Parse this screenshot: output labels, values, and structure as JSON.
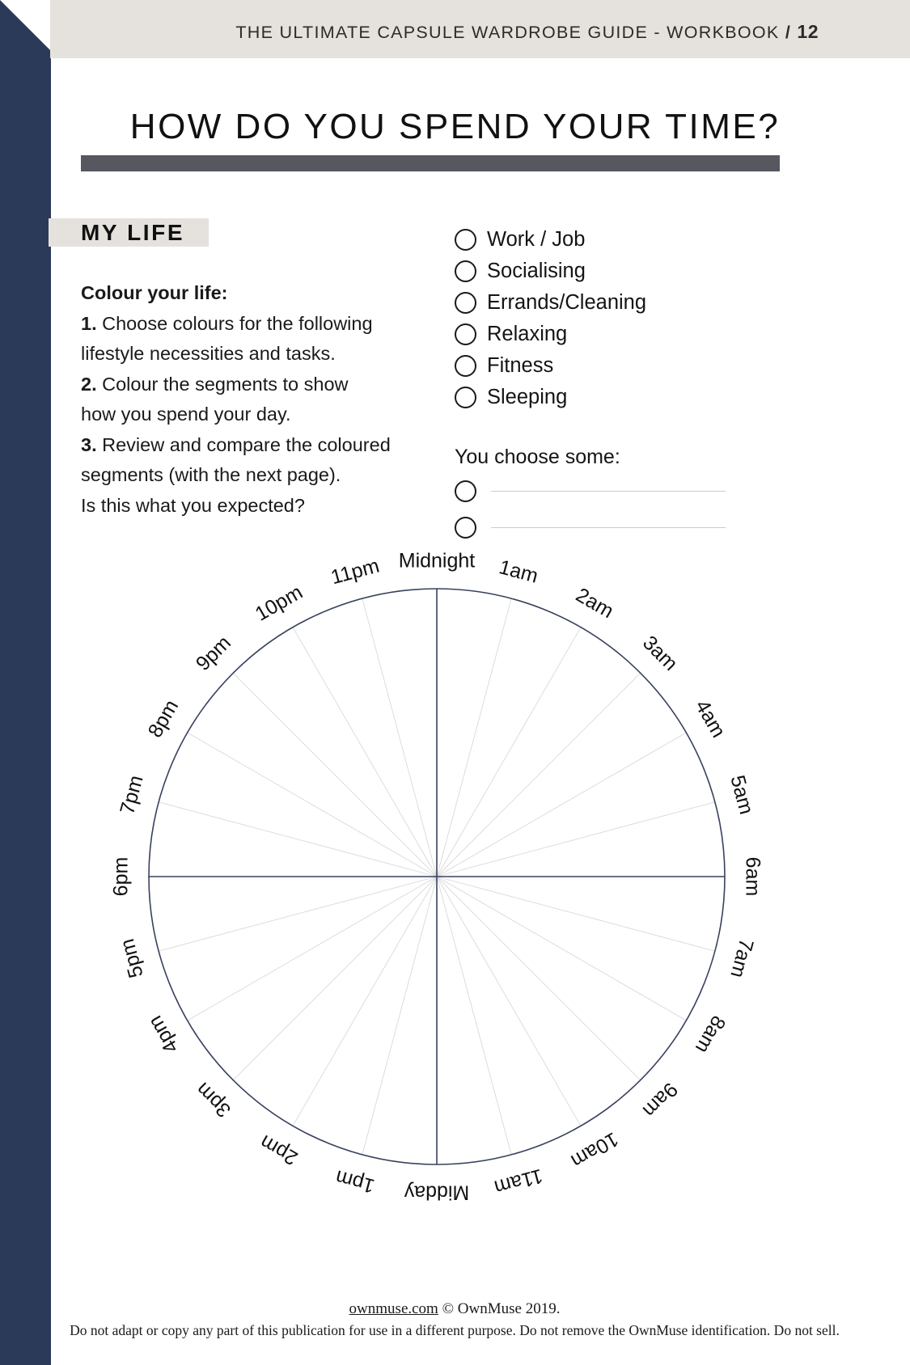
{
  "header": {
    "title": "THE ULTIMATE CAPSULE WARDROBE GUIDE - WORKBOOK",
    "separator": "/",
    "page_number": "12"
  },
  "page_title": "HOW DO YOU SPEND YOUR TIME?",
  "section": {
    "label": "MY LIFE"
  },
  "instructions": {
    "heading": "Colour your life:",
    "steps": [
      {
        "num": "1.",
        "lines": [
          "Choose colours for the following",
          "lifestyle necessities and tasks."
        ]
      },
      {
        "num": "2.",
        "lines": [
          "Colour the segments to show",
          "how you spend your day."
        ]
      },
      {
        "num": "3.",
        "lines": [
          "Review and compare the coloured",
          "segments (with the next page)."
        ]
      }
    ],
    "closing": "Is this what you expected?"
  },
  "options": {
    "items": [
      "Work / Job",
      "Socialising",
      "Errands/Cleaning",
      "Relaxing",
      "Fitness",
      "Sleeping"
    ]
  },
  "choose_some": {
    "title": "You choose some:",
    "blanks": [
      "",
      ""
    ]
  },
  "chart_data": {
    "type": "pie",
    "title": "24-hour time wheel",
    "categories": [
      "Midnight",
      "1am",
      "2am",
      "3am",
      "4am",
      "5am",
      "6am",
      "7am",
      "8am",
      "9am",
      "10am",
      "11am",
      "Midday",
      "1pm",
      "2pm",
      "3pm",
      "4pm",
      "5pm",
      "6pm",
      "7pm",
      "8pm",
      "9pm",
      "10pm",
      "11pm"
    ],
    "values": [
      1,
      1,
      1,
      1,
      1,
      1,
      1,
      1,
      1,
      1,
      1,
      1,
      1,
      1,
      1,
      1,
      1,
      1,
      1,
      1,
      1,
      1,
      1,
      1
    ],
    "segment_count": 24,
    "segment_degrees": 15,
    "filled": false,
    "axis_colors": {
      "outline": "#38415e",
      "spoke": "#d9d9d9",
      "axis": "#38415e"
    },
    "major_axes": [
      "Midnight",
      "Midday",
      "6am",
      "6pm"
    ],
    "xlabel": "",
    "ylabel": "",
    "legend": "none"
  },
  "footer": {
    "site": "ownmuse.com",
    "copyright": "© OwnMuse 2019.",
    "notice": "Do not adapt or copy any part of this publication for use in a different purpose. Do not remove the OwnMuse identification. Do not sell."
  }
}
